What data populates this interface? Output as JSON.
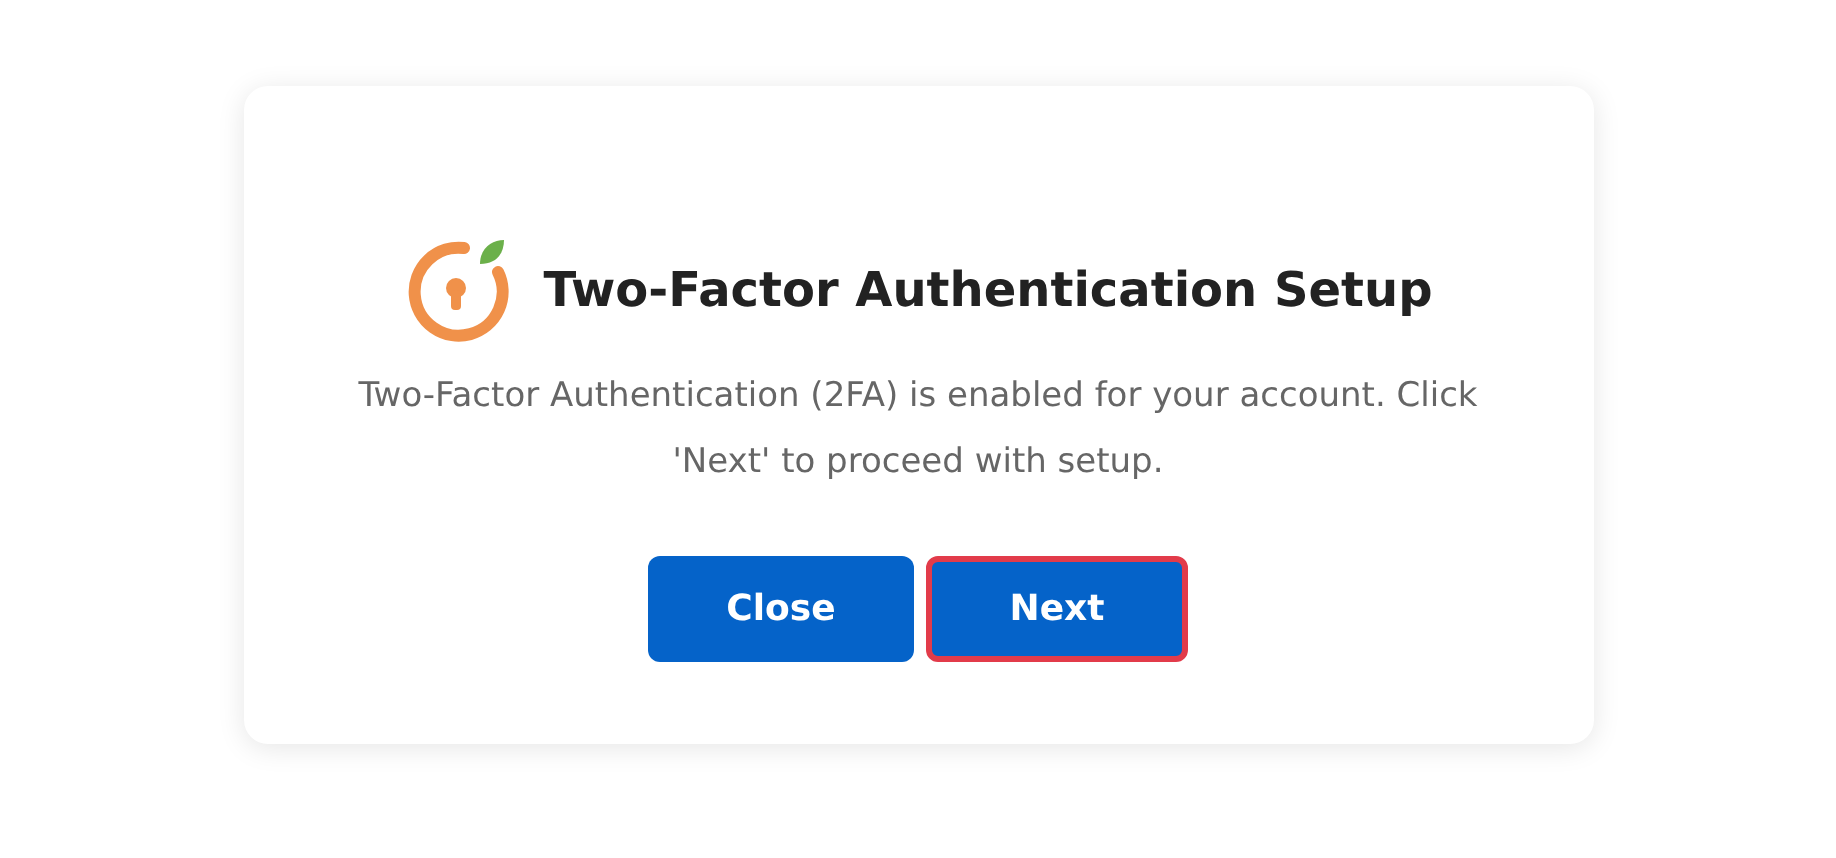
{
  "dialog": {
    "title": "Two-Factor Authentication Setup",
    "message": "Two-Factor Authentication (2FA) is enabled for your account. Click 'Next' to proceed with setup.",
    "buttons": [
      {
        "label": "Close",
        "focused": false
      },
      {
        "label": "Next",
        "focused": true
      }
    ]
  }
}
